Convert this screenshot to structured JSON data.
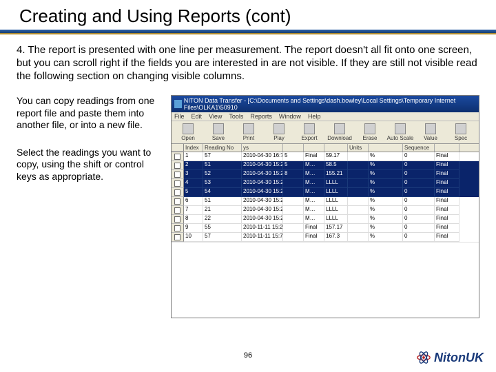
{
  "header": {
    "title": "Creating and Using Reports (cont)"
  },
  "paragraph": "4.    The report is presented with one line per measurement. The report doesn't all fit onto one screen, but you can scroll right if the fields you are interested in are not visible. If they are still not visible read the following section on changing visible columns.",
  "note1": "You can copy readings from one report file and paste them into another file, or into a new file.",
  "note2": "Select the readings you want to copy, using the shift or control keys as appropriate.",
  "page_number": "96",
  "logo_text": "NitonUK",
  "app": {
    "title": "NITON Data Transfer - [C:\\Documents and Settings\\dash.bowley\\Local Settings\\Temporary Internet Files\\OLKA1\\50910",
    "menu": [
      "File",
      "Edit",
      "View",
      "Tools",
      "Reports",
      "Window",
      "Help"
    ],
    "toolbar": [
      "Open",
      "Save",
      "Print",
      "Play",
      "Export",
      "Download",
      "Erase",
      "Auto Scale",
      "Value",
      "Spec"
    ],
    "columns": [
      "Index",
      "Reading No",
      "ys",
      "",
      "",
      "",
      "Units",
      "",
      "Sequence",
      ""
    ],
    "column_classes": [
      "col-Index",
      "col-ReadingNo",
      "col-ys",
      "col-spare",
      "col-f",
      "col-g",
      "col-Units",
      "col-h",
      "col-Sequence",
      "col-i"
    ],
    "rows": [
      {
        "sel": false,
        "cells": [
          "1",
          "57",
          "2010-04-30 16:7",
          "5",
          "Final",
          "59.17",
          "",
          "%",
          "0",
          "Final"
        ]
      },
      {
        "sel": true,
        "cells": [
          "2",
          "51",
          "2010-04-30 15:2",
          "5",
          "M…",
          "58.5",
          "",
          "%",
          "0",
          "Final"
        ]
      },
      {
        "sel": true,
        "cells": [
          "3",
          "52",
          "2010-04-30 15:2",
          "8",
          "M…",
          "155.21",
          "",
          "%",
          "0",
          "Final"
        ]
      },
      {
        "sel": true,
        "cells": [
          "4",
          "53",
          "2010-04-30 15:2",
          "",
          "M…",
          "LLLL",
          "",
          "%",
          "0",
          "Final"
        ]
      },
      {
        "sel": true,
        "cells": [
          "5",
          "54",
          "2010-04-30 15:2",
          "",
          "M…",
          "LLLL",
          "",
          "%",
          "0",
          "Final"
        ]
      },
      {
        "sel": false,
        "cells": [
          "6",
          "51",
          "2010-04-30 15:2",
          "",
          "M…",
          "LLLL",
          "",
          "%",
          "0",
          "Final"
        ]
      },
      {
        "sel": false,
        "cells": [
          "7",
          "21",
          "2010-04-30 15:2",
          "",
          "M…",
          "LLLL",
          "",
          "%",
          "0",
          "Final"
        ]
      },
      {
        "sel": false,
        "cells": [
          "8",
          "22",
          "2010-04-30 15:2",
          "",
          "M…",
          "LLLL",
          "",
          "%",
          "0",
          "Final"
        ]
      },
      {
        "sel": false,
        "cells": [
          "9",
          "55",
          "2010-11-11 15:2",
          "",
          "Final",
          "157.17",
          "",
          "%",
          "0",
          "Final"
        ]
      },
      {
        "sel": false,
        "cells": [
          "10",
          "57",
          "2010-11-11 15:7",
          "",
          "Final",
          "167.3",
          "",
          "%",
          "0",
          "Final"
        ]
      }
    ]
  }
}
